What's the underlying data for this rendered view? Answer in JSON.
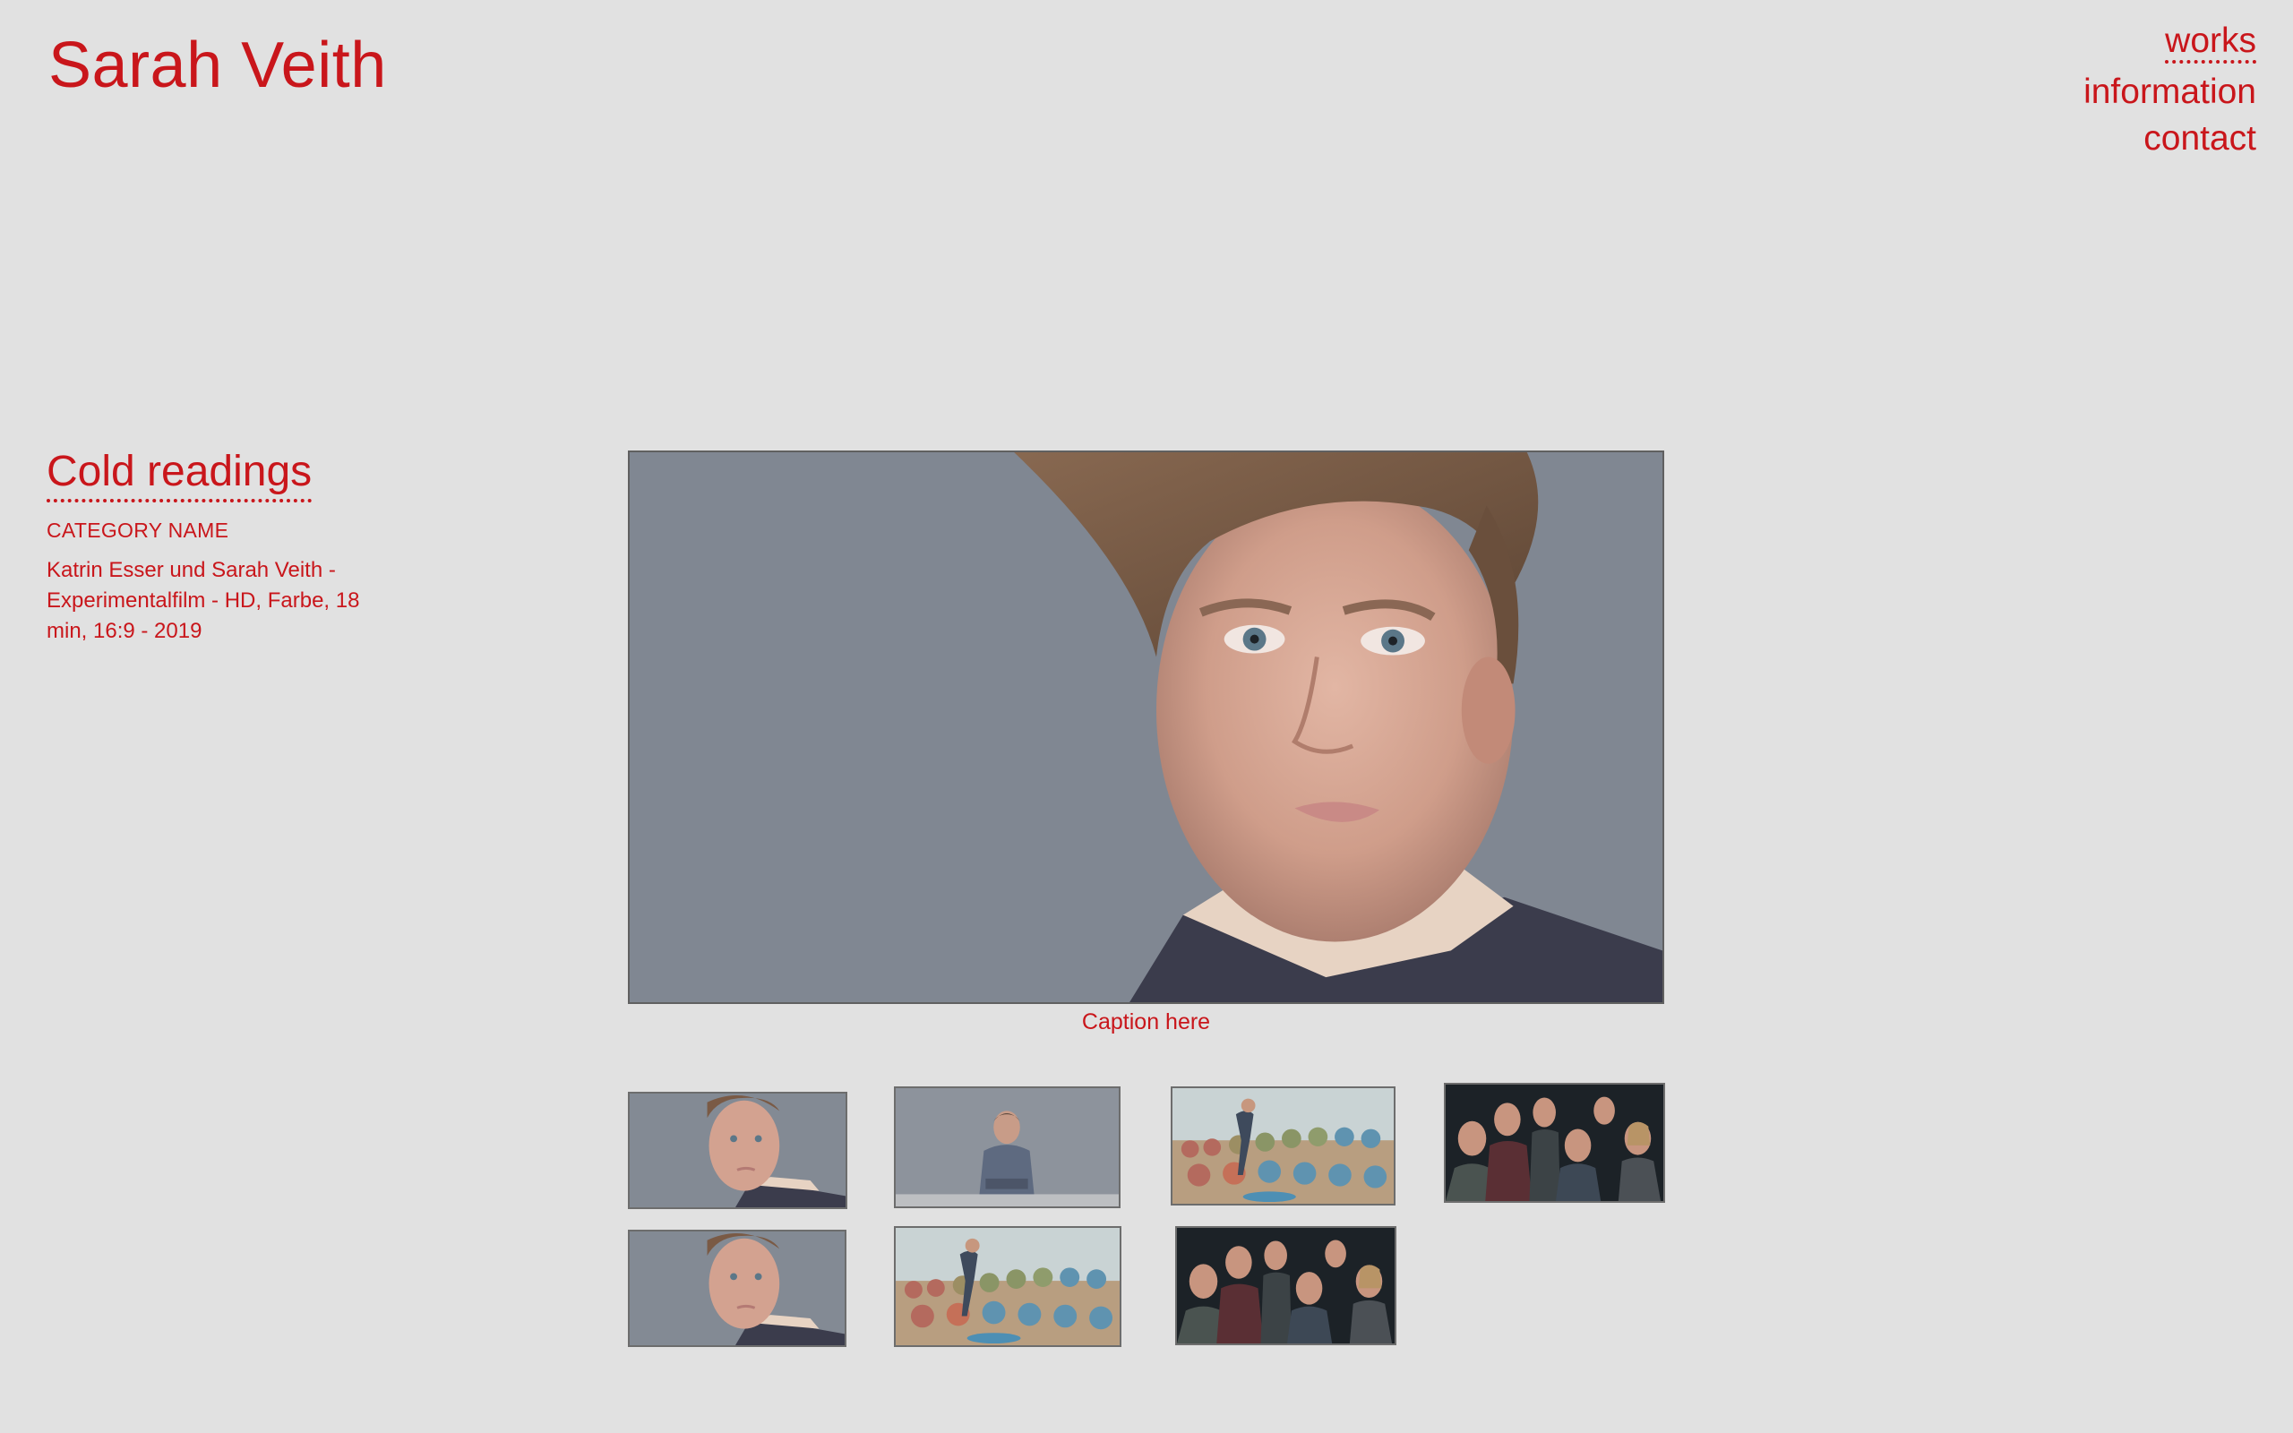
{
  "header": {
    "site_title": "Sarah Veith"
  },
  "nav": {
    "items": [
      "works",
      "information",
      "contact"
    ],
    "active": "works"
  },
  "work": {
    "title": "Cold readings",
    "category": "CATEGORY NAME",
    "description": "Katrin Esser und Sarah Veith - Experimentalfilm - HD, Farbe, 18 min, 16:9 - 2019"
  },
  "main_image": {
    "caption": "Caption here",
    "subject": "close-up-portrait-woman"
  },
  "thumbnails": [
    {
      "subject": "woman-portrait"
    },
    {
      "subject": "man-seated"
    },
    {
      "subject": "man-with-chairs"
    },
    {
      "subject": "group-of-actors"
    },
    {
      "subject": "woman-portrait"
    },
    {
      "subject": "man-with-chairs"
    },
    {
      "subject": "group-of-actors"
    }
  ],
  "colors": {
    "accent": "#c9161b",
    "background": "#e1e1e1"
  }
}
